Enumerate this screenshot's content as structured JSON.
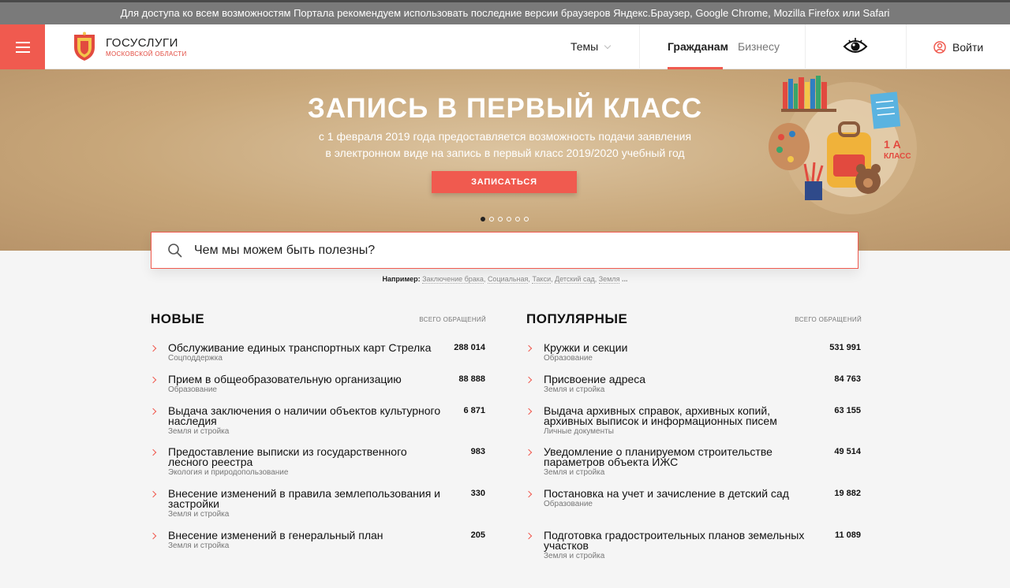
{
  "notice": "Для доступа ко всем возможностям Портала рекомендуем использовать последние версии браузеров Яндекс.Браузер, Google Chrome, Mozilla Firefox или Safari",
  "header": {
    "logo_title": "ГОСУСЛУГИ",
    "logo_sub": "МОСКОВСКОЙ ОБЛАСТИ",
    "themes": "Темы",
    "citizens": "Гражданам",
    "business": "Бизнесу",
    "login": "Войти"
  },
  "banner": {
    "title": "ЗАПИСЬ В ПЕРВЫЙ КЛАСС",
    "subtitle": "с 1 февраля 2019 года предоставляется возможность подачи заявления в электронном виде на запись в первый класс 2019/2020 учебный год",
    "button": "ЗАПИСАТЬСЯ",
    "art_label1": "1 А",
    "art_label2": "КЛАСС",
    "slide_count": 6,
    "active_slide": 1
  },
  "search": {
    "placeholder": "Чем мы можем быть полезны?",
    "examples_label": "Например:",
    "examples": [
      "Заключение брака",
      "Социальная",
      "Такси",
      "Детский сад",
      "Земля"
    ],
    "more": "..."
  },
  "new_services": {
    "title": "НОВЫЕ",
    "caption": "ВСЕГО ОБРАЩЕНИЙ",
    "items": [
      {
        "name": "Обслуживание единых транспортных карт Стрелка",
        "category": "Соцподдержка",
        "count": "288 014"
      },
      {
        "name": "Прием в общеобразовательную организацию",
        "category": "Образование",
        "count": "88 888"
      },
      {
        "name": "Выдача заключения о наличии объектов культурного наследия",
        "category": "Земля и стройка",
        "count": "6 871"
      },
      {
        "name": "Предоставление выписки из государственного лесного реестра",
        "category": "Экология и природопользование",
        "count": "983"
      },
      {
        "name": "Внесение изменений в правила землепользования и застройки",
        "category": "Земля и стройка",
        "count": "330"
      },
      {
        "name": "Внесение изменений в генеральный план",
        "category": "Земля и стройка",
        "count": "205"
      }
    ]
  },
  "popular_services": {
    "title": "ПОПУЛЯРНЫЕ",
    "caption": "ВСЕГО ОБРАЩЕНИЙ",
    "items": [
      {
        "name": "Кружки и секции",
        "category": "Образование",
        "count": "531 991"
      },
      {
        "name": "Присвоение адреса",
        "category": "Земля и стройка",
        "count": "84 763"
      },
      {
        "name": "Выдача архивных справок, архивных копий, архивных выписок и информационных писем",
        "category": "Личные документы",
        "count": "63 155"
      },
      {
        "name": "Уведомление о планируемом строительстве параметров объекта ИЖС",
        "category": "Земля и стройка",
        "count": "49 514"
      },
      {
        "name": "Постановка на учет и зачисление в детский сад",
        "category": "Образование",
        "count": "19 882"
      },
      {
        "name": "Подготовка градостроительных планов земельных участков",
        "category": "Земля и стройка",
        "count": "11 089"
      }
    ]
  },
  "colors": {
    "accent": "#f05a4f",
    "notice_bg": "#7a7a7a",
    "banner_bg": "#c8a77a"
  },
  "icons": [
    "menu-icon",
    "emblem-icon",
    "chevron-down-icon",
    "eye-icon",
    "user-icon",
    "search-icon",
    "chevron-right-icon"
  ]
}
